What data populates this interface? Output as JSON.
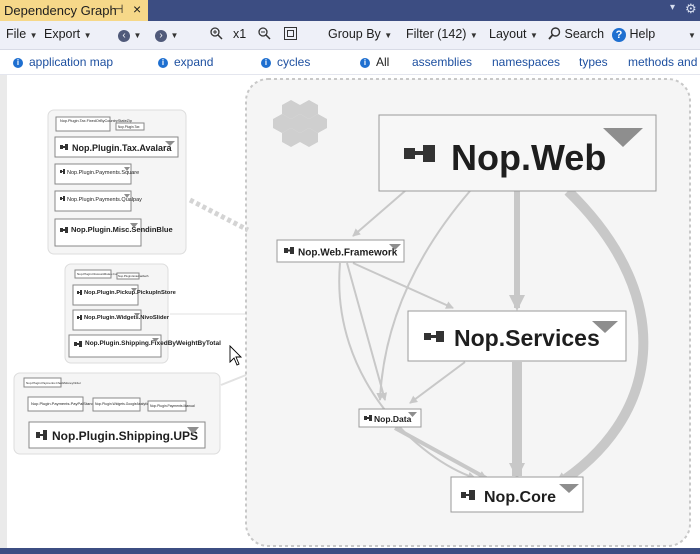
{
  "tab": {
    "title": "Dependency Graph",
    "pin_glyph": "⊣",
    "close_glyph": "×"
  },
  "tabbar": {
    "dropdown_glyph": "▾",
    "gear_glyph": "⚙"
  },
  "menubar": {
    "file": "File",
    "export": "Export",
    "zoom_level": "x1",
    "group_by": "Group By",
    "filter": "Filter (142)",
    "layout": "Layout",
    "search": "Search",
    "help": "Help"
  },
  "links": [
    {
      "label": "application map",
      "info": true
    },
    {
      "label": "expand",
      "info": true
    },
    {
      "label": "cycles",
      "info": true
    },
    {
      "label": "All",
      "info": true
    },
    {
      "label": "assemblies",
      "info": false
    },
    {
      "label": "namespaces",
      "info": false
    },
    {
      "label": "types",
      "info": false
    },
    {
      "label": "methods and fi",
      "info": false
    }
  ],
  "graph": {
    "main_nodes": {
      "web": "Nop.Web",
      "framework": "Nop.Web.Framework",
      "services": "Nop.Services",
      "data": "Nop.Data",
      "core": "Nop.Core"
    },
    "plugin_group_1": {
      "caption": "Nop.Plugin.Tax.FixedOrByCountryStateZip",
      "tiny_tag": "Nop.Plugin.Tax",
      "items": [
        "Nop.Plugin.Tax.Avalara",
        "Nop.Plugin.Payments.Square",
        "Nop.Plugin.Payments.Qualpay",
        "Nop.Plugin.Misc.SendinBlue"
      ]
    },
    "plugin_group_2": {
      "caption": "Nop.Plugin.DiscountRules.CustomerRoles",
      "tiny_tag": "Nop.Plugin.ExternalAuth",
      "items": [
        "Nop.Plugin.Pickup.PickupInStore",
        "Nop.Plugin.Widgets.NivoSlider",
        "Nop.Plugin.Shipping.FixedByWeightByTotal"
      ]
    },
    "plugin_group_3": {
      "caption": "Nop.Plugin.Payments.CheckMoneyOrder",
      "small_items": [
        "Nop.Plugin.Payments.PayPalStandard",
        "Nop.Plugin.Widgets.GoogleAnalytics",
        "Nop.Plugin.Payments.Manual"
      ],
      "main": "Nop.Plugin.Shipping.UPS"
    }
  },
  "colors": {
    "accent": "#3c4d82",
    "tab_active": "#f6d889",
    "link": "#1e50a0",
    "edge": "#c8c8c8",
    "node_border": "#9a9a9a"
  }
}
